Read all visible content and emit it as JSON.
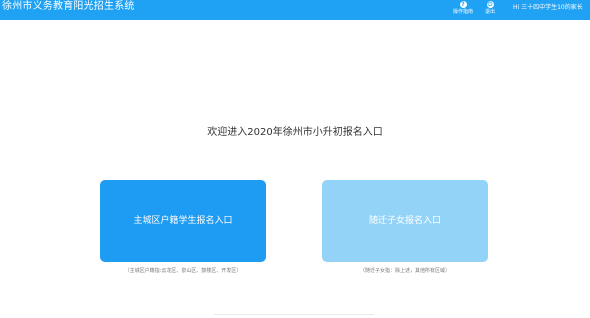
{
  "header": {
    "title": "徐州市义务教育阳光招生系统",
    "help": {
      "icon": "question-icon",
      "label": "操作指南"
    },
    "logout": {
      "icon": "logout-icon",
      "label": "退出"
    },
    "user_greeting": "Hi 三十四中学生10的家长"
  },
  "main": {
    "welcome": "欢迎进入2020年徐州市小升初报名入口",
    "entries": [
      {
        "label": "主城区户籍学生报名入口",
        "note": "（主城区户籍指:云龙区、泉山区、鼓楼区、开发区）"
      },
      {
        "label": "随迁子女报名入口",
        "note": "（随迁子女指：除上述，其他所有区域）"
      }
    ]
  },
  "colors": {
    "header_bg": "#1fa1f4",
    "primary_card": "#1e9bf3",
    "secondary_card": "#94d3f8"
  }
}
